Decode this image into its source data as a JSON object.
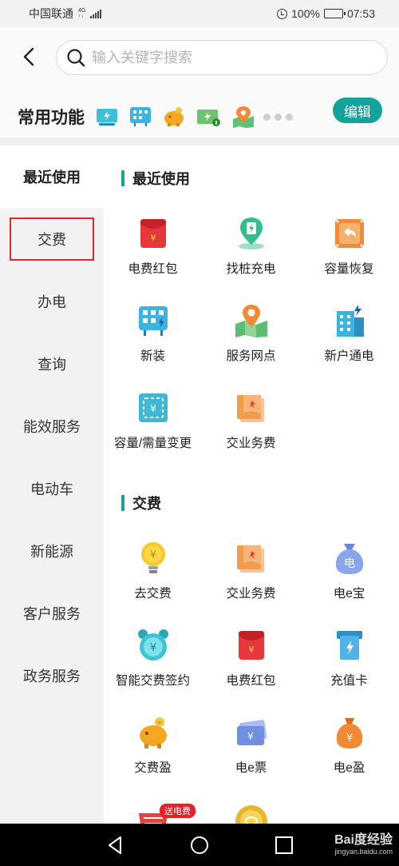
{
  "status_bar": {
    "carrier": "中国联通",
    "network": "4G",
    "battery": "100%",
    "time": "07:53"
  },
  "search": {
    "placeholder": "输入关键字搜索"
  },
  "common": {
    "title": "常用功能",
    "edit_label": "编辑",
    "icons": [
      "screen-charge-icon",
      "grid-charge-icon",
      "piggy-bank-icon",
      "card-charge-icon",
      "map-pin-icon"
    ]
  },
  "sidebar": {
    "items": [
      {
        "label": "最近使用",
        "state": "active"
      },
      {
        "label": "交费",
        "state": "highlighted"
      },
      {
        "label": "办电"
      },
      {
        "label": "查询"
      },
      {
        "label": "能效服务"
      },
      {
        "label": "电动车"
      },
      {
        "label": "新能源"
      },
      {
        "label": "客户服务"
      },
      {
        "label": "政务服务"
      }
    ]
  },
  "sections": [
    {
      "title": "最近使用",
      "items": [
        {
          "label": "电费红包",
          "icon": "red-envelope-icon"
        },
        {
          "label": "找桩充电",
          "icon": "charger-location-icon"
        },
        {
          "label": "容量恢复",
          "icon": "capacity-restore-icon"
        },
        {
          "label": "新装",
          "icon": "new-install-icon"
        },
        {
          "label": "服务网点",
          "icon": "service-map-icon"
        },
        {
          "label": "新户通电",
          "icon": "building-power-icon"
        },
        {
          "label": "容量/需量变更",
          "icon": "capacity-change-icon"
        },
        {
          "label": "交业务费",
          "icon": "business-fee-icon"
        }
      ]
    },
    {
      "title": "交费",
      "items": [
        {
          "label": "去交费",
          "icon": "bulb-coin-icon"
        },
        {
          "label": "交业务费",
          "icon": "business-fee-icon"
        },
        {
          "label": "电e宝",
          "icon": "money-bag-icon"
        },
        {
          "label": "智能交费签约",
          "icon": "alarm-clock-icon"
        },
        {
          "label": "电费红包",
          "icon": "red-envelope-icon"
        },
        {
          "label": "充值卡",
          "icon": "recharge-card-icon"
        },
        {
          "label": "交费盈",
          "icon": "piggy-bank-icon"
        },
        {
          "label": "电e票",
          "icon": "ticket-icon"
        },
        {
          "label": "电e盈",
          "icon": "coin-bag-icon"
        },
        {
          "label": "",
          "icon": "shopping-basket-icon",
          "badge": "送电费"
        },
        {
          "label": "",
          "icon": "gold-coin-icon"
        }
      ]
    }
  ],
  "watermark": {
    "brand": "Bai度经验",
    "url": "jingyan.baidu.com"
  }
}
